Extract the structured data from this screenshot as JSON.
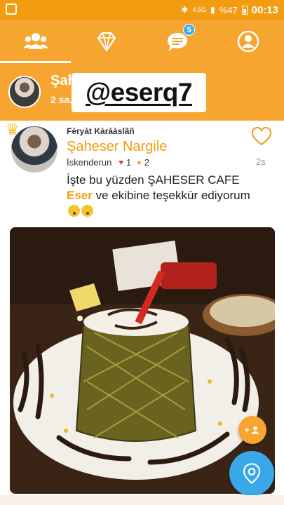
{
  "status_bar": {
    "network_label": "4.5G",
    "battery_percent": "%47",
    "time": "00:13"
  },
  "tabs": [
    {
      "name": "people-icon",
      "active": true
    },
    {
      "name": "diamond-icon",
      "active": false
    },
    {
      "name": "messages-icon",
      "active": false,
      "badge": "5"
    },
    {
      "name": "profile-icon",
      "active": false
    }
  ],
  "story": {
    "name": "Şah",
    "time": "2 sa.",
    "handle": "@eserq7"
  },
  "post": {
    "author_small": "Fèryàt Kàrààslãñ",
    "title": "Şaheser Nargile",
    "location": "İskenderun",
    "likes": "1",
    "comments": "2",
    "age": "2s",
    "text_part1": "İşte bu yüzden      ŞAHESER CAFE ",
    "text_highlight": "Eser",
    "text_part2": " ve ekibine teşekkür ediyorum"
  },
  "colors": {
    "brand_orange": "#f7a531",
    "accent_orange": "#f39c12",
    "fab_blue": "#3aa8e8",
    "badge_blue": "#3fa9f5"
  },
  "fab_small_label": "+"
}
